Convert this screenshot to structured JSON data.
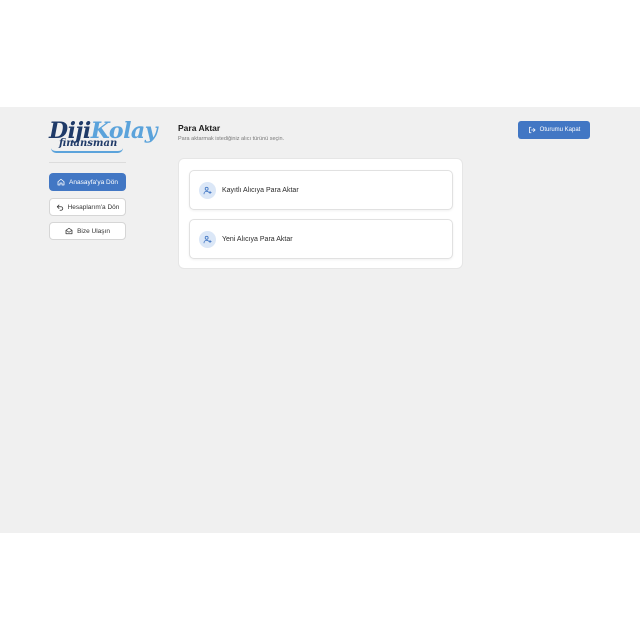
{
  "brand": {
    "logo_part1": "Diji",
    "logo_part2": "Kolay",
    "logo_sub": "finansman"
  },
  "sidebar": {
    "items": [
      {
        "label": "Anasayfa'ya Dön",
        "icon": "home-icon",
        "active": true
      },
      {
        "label": "Hesaplarım'a Dön",
        "icon": "back-arrow-icon",
        "active": false
      },
      {
        "label": "Bize Ulaşın",
        "icon": "mail-icon",
        "active": false
      }
    ]
  },
  "header": {
    "title": "Para Aktar",
    "subtitle": "Para aktarmak istediğiniz alıcı türünü seçin.",
    "close_label": "Oturumu Kapat"
  },
  "options": [
    {
      "label": "Kayıtlı Alıcıya Para Aktar",
      "icon": "user-plus-icon"
    },
    {
      "label": "Yeni Alıcıya Para Aktar",
      "icon": "user-plus-icon"
    }
  ],
  "colors": {
    "accent": "#4277c4",
    "background": "#f0f0f0",
    "logo_dark": "#1f3a68",
    "logo_light": "#5ba3db",
    "icon_bg": "#dbe7f7"
  }
}
